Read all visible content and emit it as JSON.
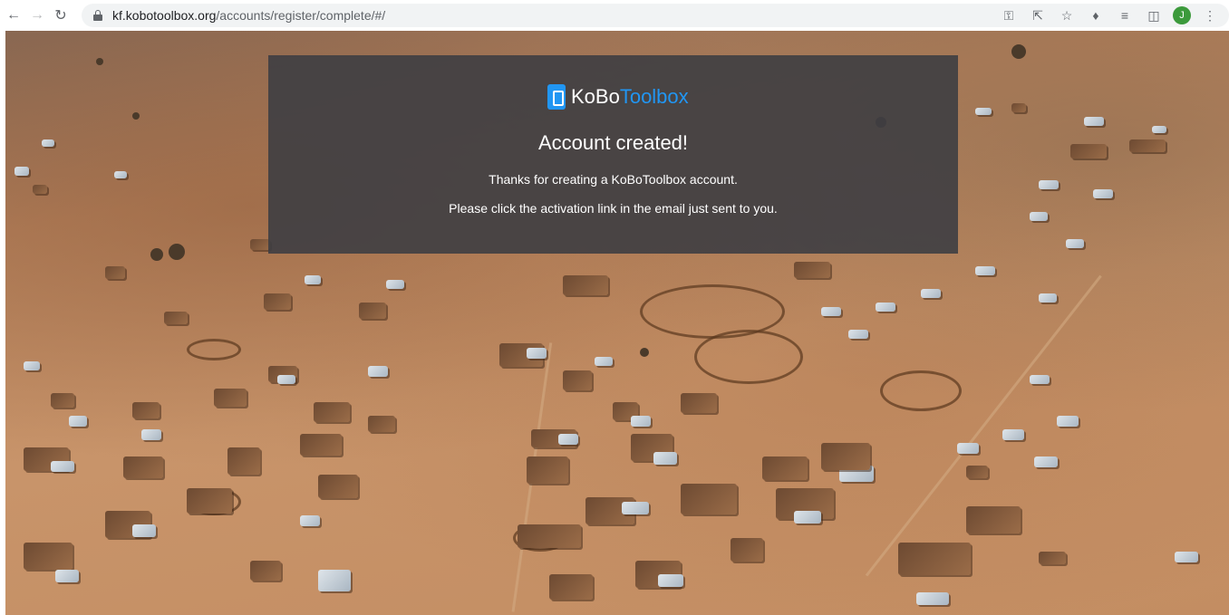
{
  "browser": {
    "url_host": "kf.kobotoolbox.org",
    "url_path": "/accounts/register/complete/#/",
    "profile_initial": "J"
  },
  "icons": {
    "back": "arrow-left-icon",
    "forward": "arrow-right-icon",
    "reload": "reload-icon",
    "lock": "lock-icon",
    "key": "key-icon",
    "share": "share-icon",
    "bookmark": "star-icon",
    "extensions": "puzzle-icon",
    "reading_list": "reading-list-icon",
    "side_panel": "side-panel-icon",
    "menu": "kebab-menu-icon"
  },
  "card": {
    "logo_ko": "KoBo",
    "logo_toolbox": "Toolbox",
    "title": "Account created!",
    "line1": "Thanks for creating a KoBoToolbox account.",
    "line2": "Please click the activation link in the email just sent to you."
  },
  "colors": {
    "brand_blue": "#2196f3",
    "card_bg": "#3e3e42",
    "avatar_green": "#3c9a3c"
  }
}
